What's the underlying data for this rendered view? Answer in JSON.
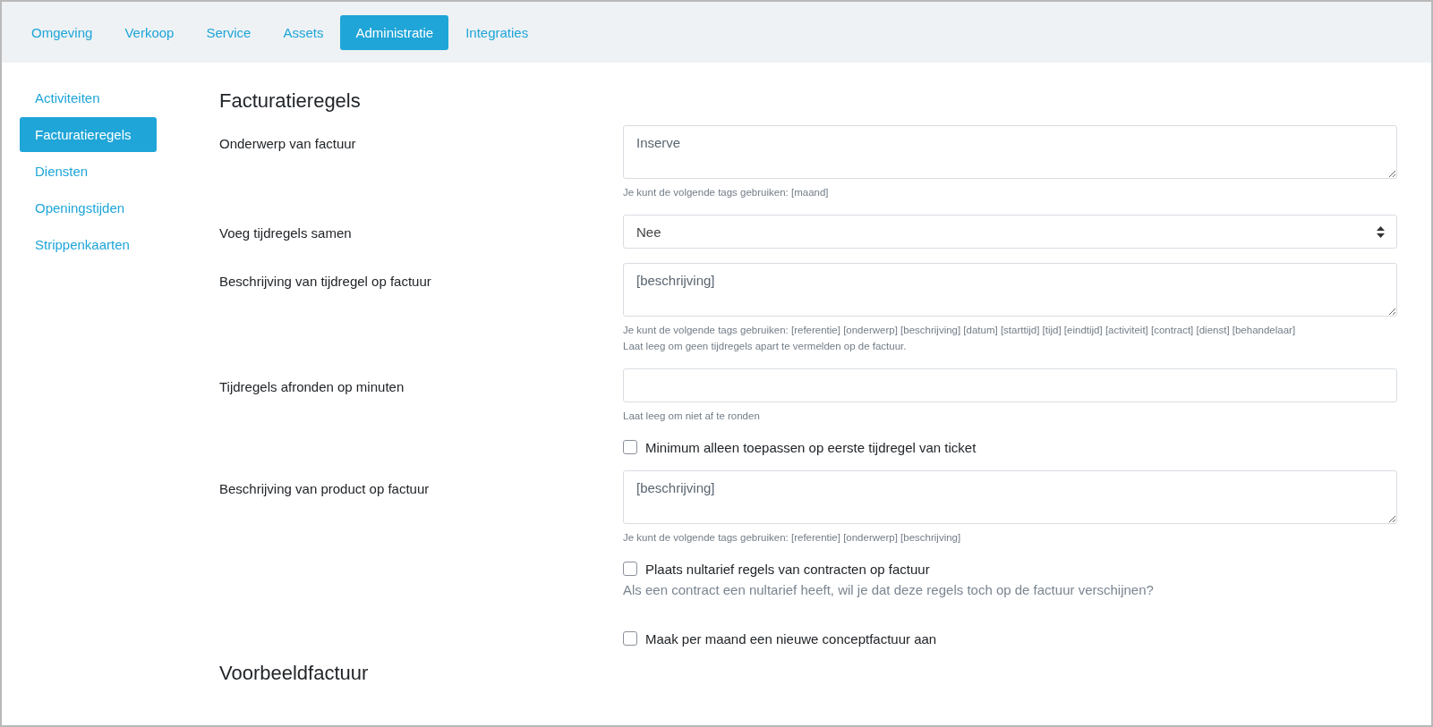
{
  "tabs": [
    {
      "label": "Omgeving",
      "selected": false
    },
    {
      "label": "Verkoop",
      "selected": false
    },
    {
      "label": "Service",
      "selected": false
    },
    {
      "label": "Assets",
      "selected": false
    },
    {
      "label": "Administratie",
      "selected": true
    },
    {
      "label": "Integraties",
      "selected": false
    }
  ],
  "sidebar": {
    "items": [
      {
        "label": "Activiteiten",
        "selected": false
      },
      {
        "label": "Facturatieregels",
        "selected": true
      },
      {
        "label": "Diensten",
        "selected": false
      },
      {
        "label": "Openingstijden",
        "selected": false
      },
      {
        "label": "Strippenkaarten",
        "selected": false
      }
    ]
  },
  "heading": "Facturatieregels",
  "form": [
    {
      "kind": "textarea",
      "label": "Onderwerp van factuur",
      "value": "Inserve",
      "help": [
        {
          "kind": "hint",
          "text": "Je kunt de volgende tags gebruiken: [maand]"
        }
      ]
    },
    {
      "kind": "select",
      "label": "Voeg tijdregels samen",
      "value": "Nee"
    },
    {
      "kind": "textarea",
      "label": "Beschrijving van tijdregel op factuur",
      "value": "[beschrijving]",
      "help": [
        {
          "kind": "hint",
          "text": "Je kunt de volgende tags gebruiken: [referentie] [onderwerp] [beschrijving] [datum] [starttijd] [tijd] [eindtijd] [activiteit] [contract] [dienst] [behandelaar]"
        },
        {
          "kind": "hint",
          "text": "Laat leeg om geen tijdregels apart te vermelden op de factuur."
        }
      ]
    },
    {
      "kind": "input",
      "label": "Tijdregels afronden op minuten",
      "help": [
        {
          "kind": "hint",
          "text": "Laat leeg om niet af te ronden"
        }
      ]
    },
    {
      "kind": "checkbox",
      "label": "Minimum alleen toepassen op eerste tijdregel van ticket",
      "checked": false
    },
    {
      "kind": "textarea",
      "label": "Beschrijving van product op factuur",
      "value": "[beschrijving]",
      "help": [
        {
          "kind": "hint",
          "text": "Je kunt de volgende tags gebruiken: [referentie] [onderwerp] [beschrijving]"
        }
      ]
    },
    {
      "kind": "checkbox",
      "label": "Plaats nultarief regels van contracten op factuur",
      "checked": false,
      "help": [
        {
          "kind": "note",
          "text": "Als een contract een nultarief heeft, wil je dat deze regels toch op de factuur verschijnen?"
        }
      ]
    },
    {
      "kind": "checkbox",
      "label": "Maak per maand een nieuwe conceptfactuur aan",
      "checked": false
    }
  ],
  "next_heading": "Voorbeeldfactuur"
}
